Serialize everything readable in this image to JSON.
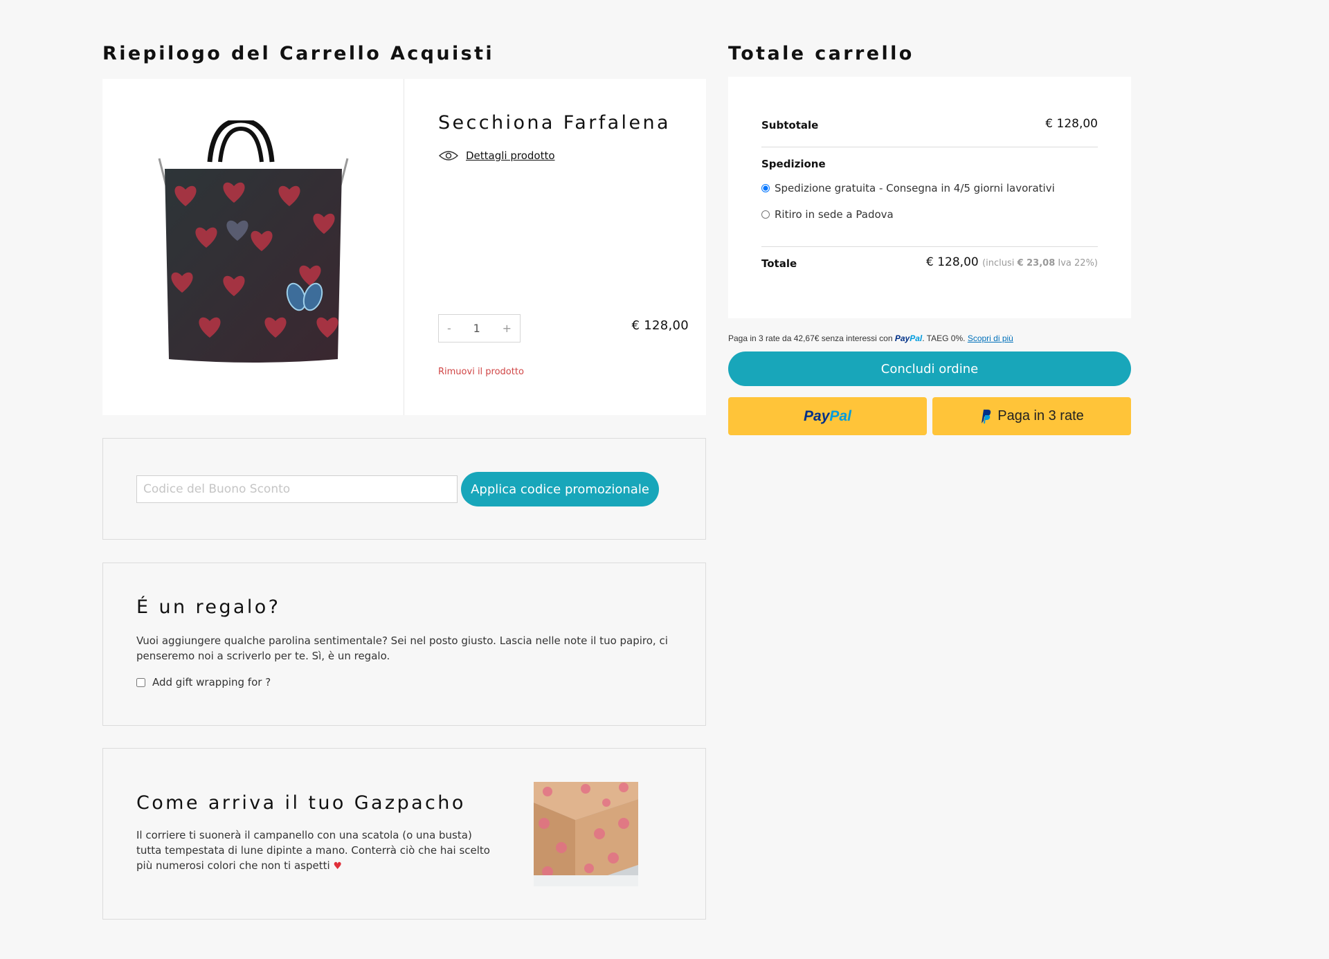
{
  "left_title": "Riepilogo del Carrello Acquisti",
  "right_title": "Totale carrello",
  "product": {
    "name": "Secchiona Farfalena",
    "details_label": "Dettagli prodotto",
    "qty_minus": "-",
    "qty": "1",
    "qty_plus": "+",
    "price": "€ 128,00",
    "remove_label": "Rimuovi il prodotto"
  },
  "coupon": {
    "placeholder": "Codice del Buono Sconto",
    "button_label": "Applica codice promozionale"
  },
  "gift": {
    "title": "É un regalo?",
    "description": "Vuoi aggiungere qualche parolina sentimentale? Sei nel posto giusto. Lascia nelle note il tuo papiro, ci penseremo noi a scriverlo per te. Sì, è un regalo.",
    "checkbox_label": "Add gift wrapping for ?"
  },
  "delivery": {
    "title": "Come arriva il tuo Gazpacho",
    "description": "Il corriere ti suonerà il campanello con una scatola (o una busta) tutta tempestata di lune dipinte a mano. Conterrà ciò che hai scelto più numerosi colori che non ti aspetti",
    "heart": "♥"
  },
  "totals": {
    "subtotal_label": "Subtotale",
    "subtotal_value": "€ 128,00",
    "shipping_label": "Spedizione",
    "shipping_options": [
      {
        "label": "Spedizione gratuita - Consegna in 4/5 giorni lavorativi",
        "selected": true
      },
      {
        "label": "Ritiro in sede a Padova",
        "selected": false
      }
    ],
    "total_label": "Totale",
    "total_value": "€ 128,00",
    "tax_prefix": "(inclusi",
    "tax_amount": "€ 23,08",
    "tax_suffix": "Iva 22%)"
  },
  "paypal": {
    "message_prefix": "Paga in 3 rate da 42,67€ senza interessi con",
    "brand_pay": "Pay",
    "brand_pal": "Pal",
    "message_suffix": ". TAEG 0%.",
    "learn_more": "Scopri di più",
    "checkout_label": "Concludi ordine",
    "pay_in_3_label": "Paga in 3 rate"
  },
  "colors": {
    "accent": "#18a6ba",
    "paypal_yellow": "#ffc439",
    "remove_red": "#d04545"
  }
}
